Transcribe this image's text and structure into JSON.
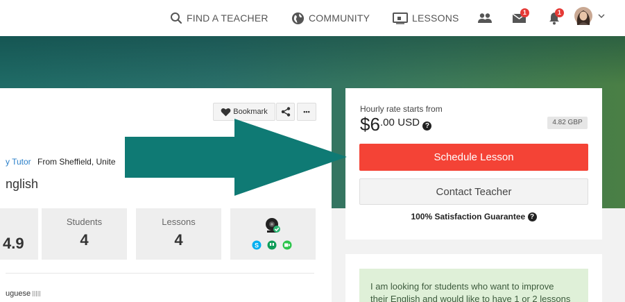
{
  "nav": {
    "find_teacher": "FIND A TEACHER",
    "community": "COMMUNITY",
    "lessons": "LESSONS",
    "messages_badge": "1",
    "notifications_badge": "1"
  },
  "profile": {
    "bookmark_label": "Bookmark",
    "more_label": "•••",
    "tutor_type": "y Tutor",
    "from": "From Sheffield, Unite",
    "teaches": "nglish",
    "rating": "4.9",
    "students_label": "Students",
    "students_value": "4",
    "lessons_label": "Lessons",
    "lessons_value": "4",
    "speaks": "uguese"
  },
  "pricing": {
    "rate_label": "Hourly rate starts from",
    "currency_symbol": "$",
    "price_whole": "6",
    "price_cents": ".00",
    "currency": "USD",
    "gbp_badge": "4.82 GBP",
    "schedule_label": "Schedule Lesson",
    "contact_label": "Contact Teacher",
    "guarantee_label": "100% Satisfaction Guarantee"
  },
  "about": {
    "line1": "I am looking for students who want to improve",
    "line2": "their English and would like to have 1 or 2 lessons"
  },
  "colors": {
    "schedule": "#f44336",
    "arrow": "#0f7a74",
    "banner": "#2a6f69",
    "about_bg": "#dff0d8"
  }
}
